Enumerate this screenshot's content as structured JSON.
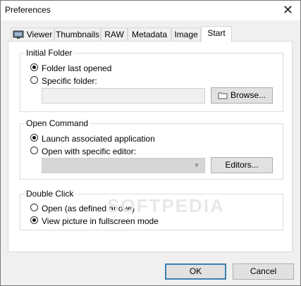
{
  "window": {
    "title": "Preferences",
    "close_glyph": "✕"
  },
  "tabs": [
    {
      "label": "Viewer",
      "icon": "monitor-icon"
    },
    {
      "label": "Thumbnails"
    },
    {
      "label": "RAW"
    },
    {
      "label": "Metadata"
    },
    {
      "label": "Image"
    },
    {
      "label": "Start",
      "active": true
    }
  ],
  "initial_folder": {
    "legend": "Initial Folder",
    "options": [
      {
        "label": "Folder last opened",
        "selected": true
      },
      {
        "label": "Specific folder:",
        "selected": false
      }
    ],
    "path_value": "",
    "browse_label": "Browse...",
    "browse_icon": "folder-icon"
  },
  "open_command": {
    "legend": "Open Command",
    "options": [
      {
        "label": "Launch associated application",
        "selected": true
      },
      {
        "label": "Open with specific editor:",
        "selected": false
      }
    ],
    "editor_value": "",
    "editors_label": "Editors..."
  },
  "double_click": {
    "legend": "Double Click",
    "options": [
      {
        "label": "Open (as defined above)",
        "selected": false
      },
      {
        "label": "View picture in fullscreen mode",
        "selected": true
      }
    ]
  },
  "footer": {
    "ok_label": "OK",
    "cancel_label": "Cancel"
  },
  "watermark": "SOFTPEDIA"
}
